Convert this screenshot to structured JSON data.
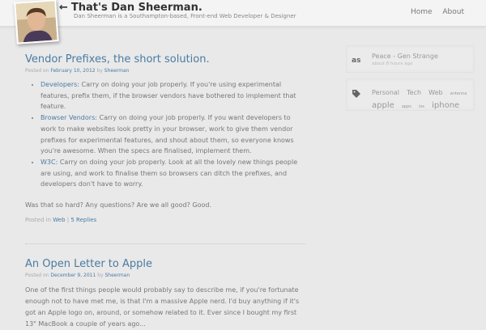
{
  "header": {
    "title_arrow": "←",
    "title": "That's Dan Sheerman.",
    "tagline": "Dan Sheerman is a Southampton-based, Front-end Web Developer & Designer",
    "nav": [
      "Home",
      "About"
    ]
  },
  "posts": [
    {
      "title": "Vendor Prefixes, the short solution.",
      "meta_prefix": "Posted on",
      "date": "February 10, 2012",
      "meta_by": "by",
      "author": "Sheerman",
      "items": [
        {
          "label": "Developers:",
          "text": " Carry on doing your job properly. If you're using experimental features, prefix them, if the browser vendors have bothered to implement that feature."
        },
        {
          "label": "Browser Vendors:",
          "text": " Carry on doing your job properly. If you want developers to work to make websites look pretty in your browser, work to give them vendor prefixes for experimental features, and shout about them, so everyone knows you're awesome. When the specs are finalised, implement them."
        },
        {
          "label": "W3C:",
          "text": " Carry on doing your job properly. Look at all the lovely new things people are using, and work to finalise them so browsers can ditch the prefixes, and developers don't have to worry."
        }
      ],
      "closing": "Was that so hard? Any questions? Are we all good? Good.",
      "footer_prefix": "Posted in",
      "category": "Web",
      "footer_sep": "|",
      "replies": "5 Replies"
    },
    {
      "title": "An Open Letter to Apple",
      "meta_prefix": "Posted on",
      "date": "December 9, 2011",
      "meta_by": "by",
      "author": "Sheerman",
      "intro": "One of the first things people would probably say to describe me, if you're fortunate enough not to have met me, is that I'm a massive Apple nerd. I'd buy anything if it's got an Apple logo on, around, or somehow related to it. Ever since I bought my first 13\" MacBook a couple of years ago..."
    }
  ],
  "sidebar": {
    "lastfm": {
      "icon": "lastfm-icon",
      "track": "Peace - Gen Strange",
      "time": "about 8 hours ago"
    },
    "tags": {
      "icon": "tag-icon",
      "items": [
        {
          "name": "Personal",
          "size": 8
        },
        {
          "name": "Tech",
          "size": 8
        },
        {
          "name": "Web",
          "size": 8
        },
        {
          "name": "antenna",
          "size": 5
        },
        {
          "name": "apple",
          "size": 10
        },
        {
          "name": "apps",
          "size": 5
        },
        {
          "name": "ios",
          "size": 5
        },
        {
          "name": "iphone",
          "size": 10
        }
      ]
    }
  }
}
